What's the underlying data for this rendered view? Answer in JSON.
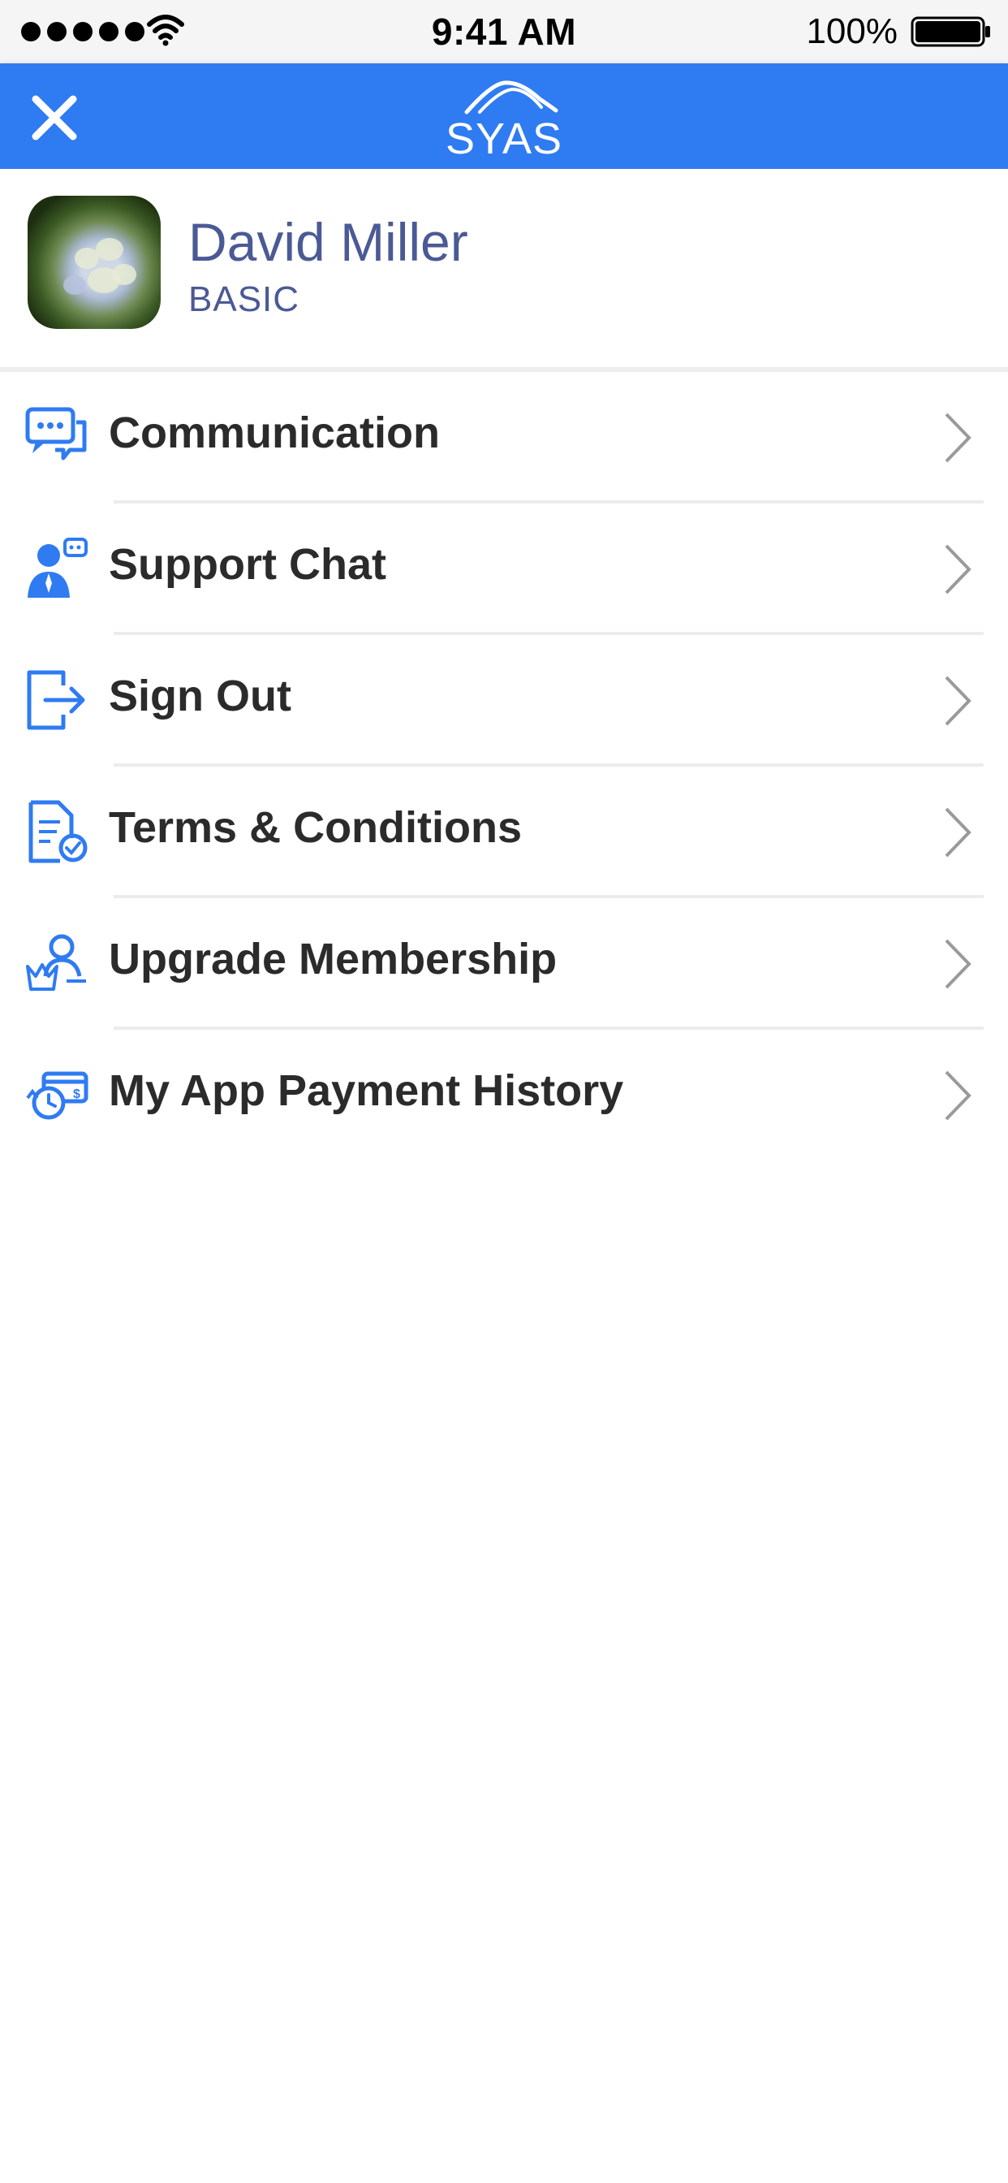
{
  "status_bar": {
    "time": "9:41 AM",
    "battery_percent": "100%",
    "icons": [
      "signal-dots-icon",
      "wifi-icon",
      "battery-icon"
    ]
  },
  "header": {
    "logo_text": "SYAS",
    "close_icon": "close-icon",
    "background_color": "#2f7bf2"
  },
  "profile": {
    "name": "David Miller",
    "tier": "BASIC",
    "text_color": "#4b5a95"
  },
  "menu": {
    "items": [
      {
        "label": "Communication",
        "icon": "chat-bubbles-icon"
      },
      {
        "label": "Support Chat",
        "icon": "support-agent-icon"
      },
      {
        "label": "Sign Out",
        "icon": "sign-out-icon"
      },
      {
        "label": "Terms & Conditions",
        "icon": "document-check-icon"
      },
      {
        "label": "Upgrade Membership",
        "icon": "crown-user-icon"
      },
      {
        "label": "My App Payment History",
        "icon": "payment-history-icon"
      }
    ],
    "icon_color": "#2f7bf2"
  }
}
